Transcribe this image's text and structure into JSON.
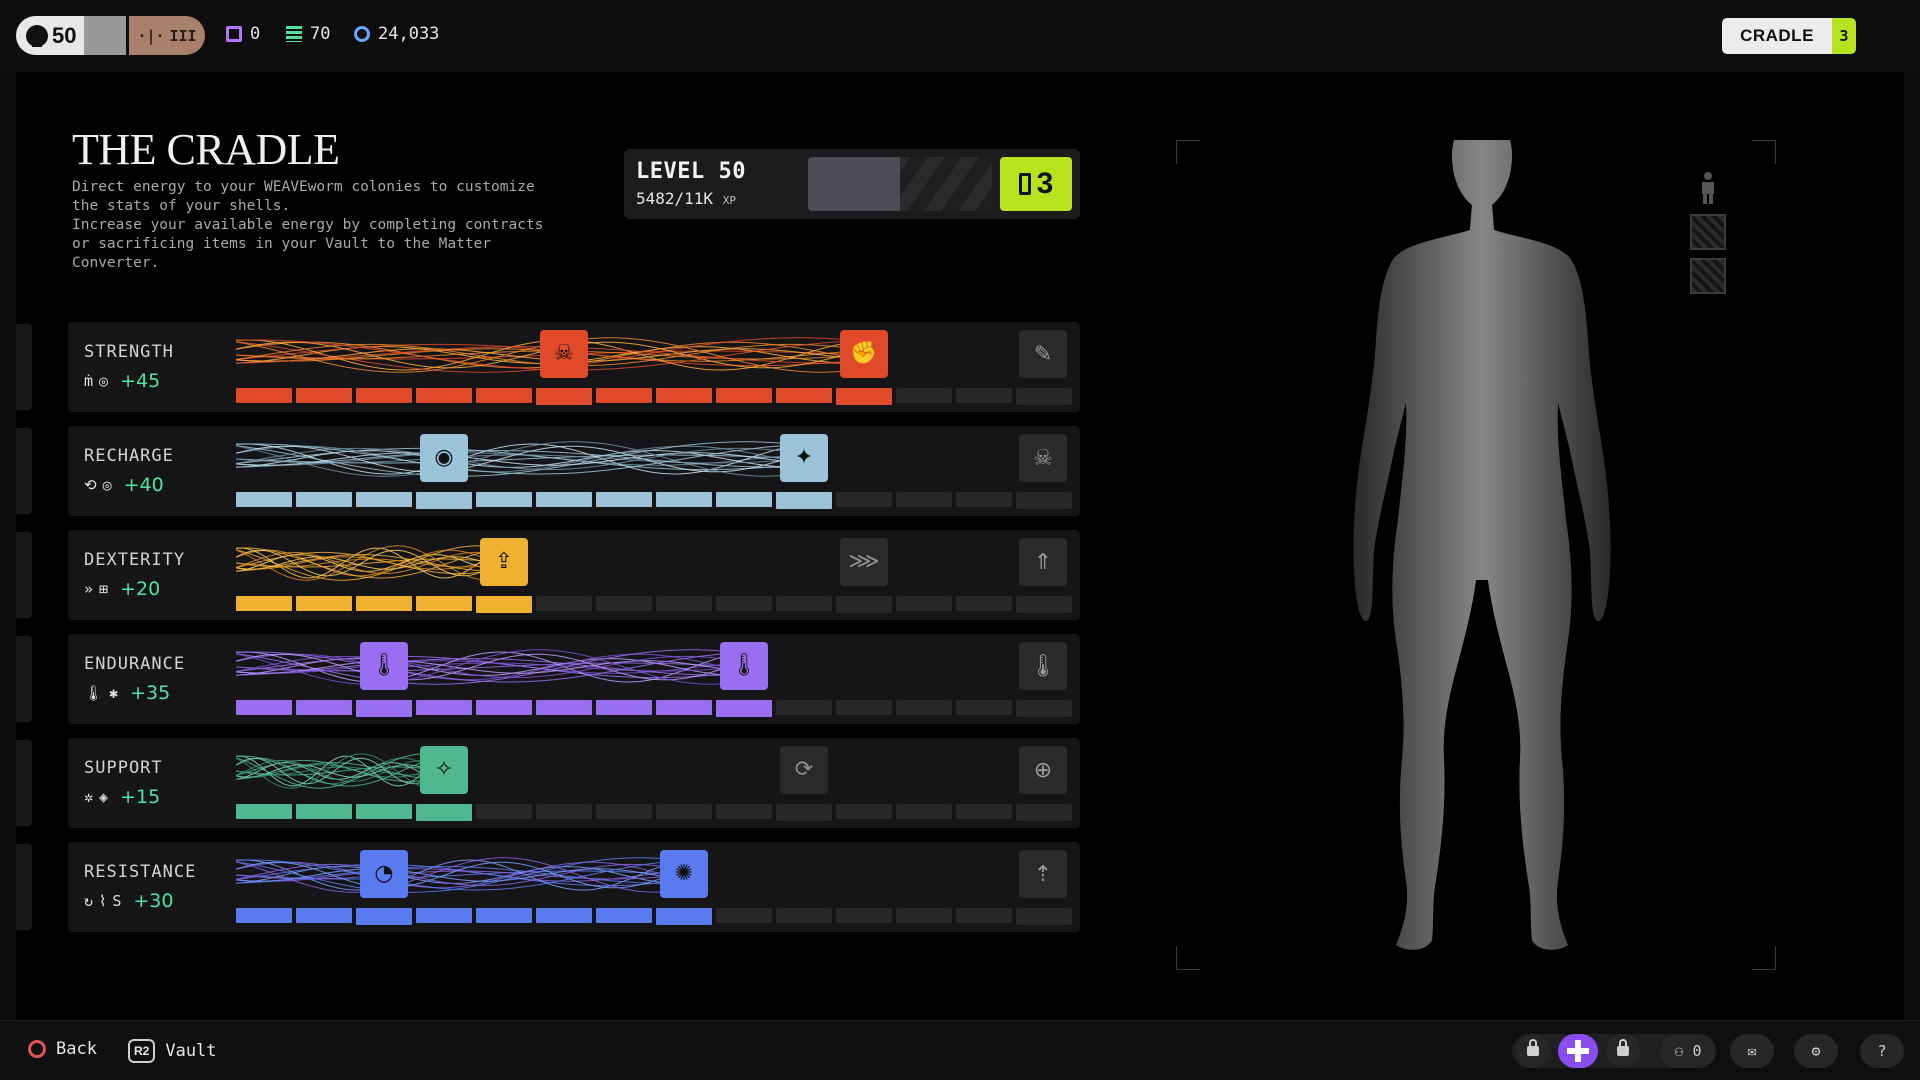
{
  "topbar": {
    "level": "50",
    "path_icons": [
      "·|·",
      "III"
    ],
    "currencies": [
      {
        "name": "chip-icon",
        "value": "0",
        "color": "#b576ff"
      },
      {
        "name": "stack-icon",
        "value": "70",
        "color": "#4fe3a0"
      },
      {
        "name": "crystal-icon",
        "value": "24,033",
        "color": "#6aa6ff"
      }
    ],
    "location": "CRADLE",
    "location_count": "3"
  },
  "page": {
    "title": "THE CRADLE",
    "description": "Direct energy to your WEAVEworm colonies to customize\nthe stats of your shells.\nIncrease your available energy by completing contracts\nor sacrificing items in your Vault to the Matter\nConverter."
  },
  "level_card": {
    "label": "LEVEL 50",
    "xp_value": "5482/11K",
    "xp_unit": "XP",
    "xp_progress": 0.5,
    "points": "3"
  },
  "stats": [
    {
      "name": "STRENGTH",
      "bonus": "+45",
      "color": "#e04a2a",
      "strand_colors": [
        "#e04a2a",
        "#f08a2a",
        "#ffb03a"
      ],
      "filled": 11,
      "total": 14,
      "mod_icons": [
        "ṁ",
        "◎"
      ],
      "nodes": [
        {
          "seg": 5,
          "glyph": "☠"
        },
        {
          "seg": 10,
          "glyph": "✊"
        }
      ],
      "end_glyph": "✎"
    },
    {
      "name": "RECHARGE",
      "bonus": "+40",
      "color": "#9cc4d8",
      "strand_colors": [
        "#9cc4d8",
        "#6e8ea2",
        "#c9e2ee"
      ],
      "filled": 10,
      "total": 14,
      "mod_icons": [
        "⟲",
        "◎"
      ],
      "nodes": [
        {
          "seg": 3,
          "glyph": "◉"
        },
        {
          "seg": 9,
          "glyph": "✦"
        }
      ],
      "end_glyph": "☠"
    },
    {
      "name": "DEXTERITY",
      "bonus": "+20",
      "color": "#f0b030",
      "strand_colors": [
        "#f0b030",
        "#d88a20",
        "#ffd060"
      ],
      "filled": 5,
      "total": 14,
      "mod_icons": [
        "»",
        "⊞"
      ],
      "nodes": [
        {
          "seg": 4,
          "glyph": "⇪"
        }
      ],
      "locked_nodes": [
        {
          "seg": 10,
          "glyph": "⋙"
        }
      ],
      "end_glyph": "⇑"
    },
    {
      "name": "ENDURANCE",
      "bonus": "+35",
      "color": "#9a6ef0",
      "strand_colors": [
        "#9a6ef0",
        "#7a50d0",
        "#c0a0ff"
      ],
      "filled": 9,
      "total": 14,
      "mod_icons": [
        "🌡",
        "✱"
      ],
      "nodes": [
        {
          "seg": 2,
          "glyph": "🌡"
        },
        {
          "seg": 8,
          "glyph": "🌡"
        }
      ],
      "end_glyph": "🌡"
    },
    {
      "name": "SUPPORT",
      "bonus": "+15",
      "color": "#50b890",
      "strand_colors": [
        "#50b890",
        "#3a8a6e",
        "#80d8b0"
      ],
      "filled": 4,
      "total": 14,
      "mod_icons": [
        "✲",
        "◈"
      ],
      "nodes": [
        {
          "seg": 3,
          "glyph": "✧"
        }
      ],
      "locked_nodes": [
        {
          "seg": 9,
          "glyph": "⟳"
        }
      ],
      "end_glyph": "⊕"
    },
    {
      "name": "RESISTANCE",
      "bonus": "+30",
      "color": "#5a7af0",
      "strand_colors": [
        "#5a7af0",
        "#8a60e0",
        "#7aa0ff"
      ],
      "filled": 8,
      "total": 14,
      "mod_icons": [
        "↻",
        "⌇",
        "S"
      ],
      "nodes": [
        {
          "seg": 2,
          "glyph": "◔"
        },
        {
          "seg": 7,
          "glyph": "✺"
        }
      ],
      "end_glyph": "⇡"
    }
  ],
  "bottombar": {
    "back_label": "Back",
    "vault_button": "R2",
    "vault_label": "Vault",
    "squad_count": "0"
  }
}
